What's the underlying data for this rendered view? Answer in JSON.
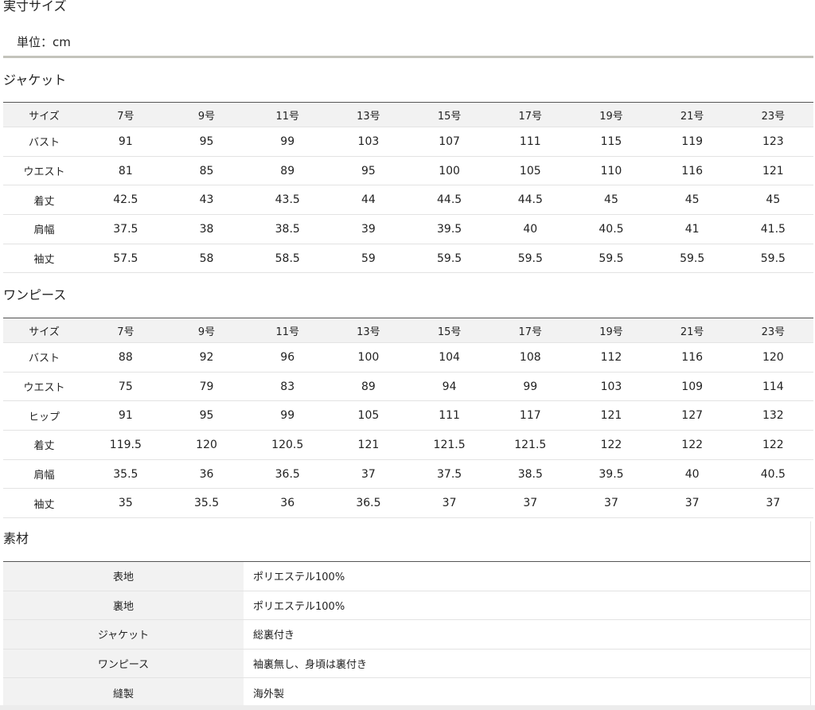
{
  "page_title": "実寸サイズ",
  "unit_label": "単位：cm",
  "jacket": {
    "title": "ジャケット",
    "header": [
      "サイズ",
      "7号",
      "9号",
      "11号",
      "13号",
      "15号",
      "17号",
      "19号",
      "21号",
      "23号"
    ],
    "rows": [
      [
        "バスト",
        "91",
        "95",
        "99",
        "103",
        "107",
        "111",
        "115",
        "119",
        "123"
      ],
      [
        "ウエスト",
        "81",
        "85",
        "89",
        "95",
        "100",
        "105",
        "110",
        "116",
        "121"
      ],
      [
        "着丈",
        "42.5",
        "43",
        "43.5",
        "44",
        "44.5",
        "44.5",
        "45",
        "45",
        "45"
      ],
      [
        "肩幅",
        "37.5",
        "38",
        "38.5",
        "39",
        "39.5",
        "40",
        "40.5",
        "41",
        "41.5"
      ],
      [
        "袖丈",
        "57.5",
        "58",
        "58.5",
        "59",
        "59.5",
        "59.5",
        "59.5",
        "59.5",
        "59.5"
      ]
    ]
  },
  "onepiece": {
    "title": "ワンピース",
    "header": [
      "サイズ",
      "7号",
      "9号",
      "11号",
      "13号",
      "15号",
      "17号",
      "19号",
      "21号",
      "23号"
    ],
    "rows": [
      [
        "バスト",
        "88",
        "92",
        "96",
        "100",
        "104",
        "108",
        "112",
        "116",
        "120"
      ],
      [
        "ウエスト",
        "75",
        "79",
        "83",
        "89",
        "94",
        "99",
        "103",
        "109",
        "114"
      ],
      [
        "ヒップ",
        "91",
        "95",
        "99",
        "105",
        "111",
        "117",
        "121",
        "127",
        "132"
      ],
      [
        "着丈",
        "119.5",
        "120",
        "120.5",
        "121",
        "121.5",
        "121.5",
        "122",
        "122",
        "122"
      ],
      [
        "肩幅",
        "35.5",
        "36",
        "36.5",
        "37",
        "37.5",
        "38.5",
        "39.5",
        "40",
        "40.5"
      ],
      [
        "袖丈",
        "35",
        "35.5",
        "36",
        "36.5",
        "37",
        "37",
        "37",
        "37",
        "37"
      ]
    ]
  },
  "material": {
    "title": "素材",
    "rows": [
      {
        "label": "表地",
        "value": "ポリエステル100%"
      },
      {
        "label": "裏地",
        "value": "ポリエステル100%"
      },
      {
        "label": "ジャケット",
        "value": "総裏付き"
      },
      {
        "label": "ワンピース",
        "value": "袖裏無し、身頃は裏付き"
      },
      {
        "label": "縫製",
        "value": "海外製"
      }
    ]
  }
}
